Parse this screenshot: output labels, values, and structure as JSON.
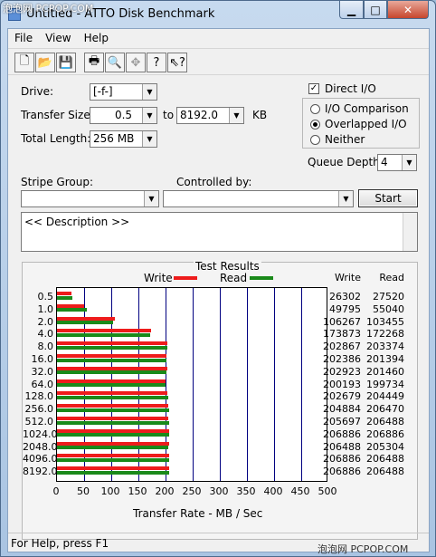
{
  "window": {
    "title": "Untitled - ATTO Disk Benchmark",
    "watermark_top": "泡泡网 PCPOP.COM",
    "watermark_bottom": "泡泡网 PCPOP.COM"
  },
  "menu": [
    "File",
    "View",
    "Help"
  ],
  "toolbar": [
    "new-icon",
    "open-icon",
    "save-icon",
    "print-icon",
    "print-preview-icon",
    "move-icon",
    "help-icon",
    "context-help-icon"
  ],
  "settings": {
    "drive_label": "Drive:",
    "drive_value": "[-f-]",
    "transfer_label": "Transfer Size:",
    "transfer_from": "0.5",
    "to_label": "to",
    "transfer_to": "8192.0",
    "kb_label": "KB",
    "length_label": "Total Length:",
    "length_value": "256 MB",
    "direct_io": "Direct I/O",
    "io_comparison": "I/O Comparison",
    "overlapped_io": "Overlapped I/O",
    "neither": "Neither",
    "queue_label": "Queue Depth:",
    "queue_value": "4",
    "stripe_label": "Stripe Group:",
    "controlled_label": "Controlled by:",
    "start_button": "Start",
    "description": "<< Description >>"
  },
  "results": {
    "title": "Test Results",
    "legend_write": "Write",
    "legend_read": "Read",
    "col_write": "Write",
    "col_read": "Read",
    "xlabel": "Transfer Rate - MB / Sec",
    "xticks": [
      "0",
      "50",
      "100",
      "150",
      "200",
      "250",
      "300",
      "350",
      "400",
      "450",
      "500"
    ]
  },
  "chart_data": {
    "type": "bar",
    "title": "Test Results",
    "xlabel": "Transfer Rate - MB / Sec",
    "xlim": [
      0,
      500
    ],
    "categories": [
      "0.5",
      "1.0",
      "2.0",
      "4.0",
      "8.0",
      "16.0",
      "32.0",
      "64.0",
      "128.0",
      "256.0",
      "512.0",
      "1024.0",
      "2048.0",
      "4096.0",
      "8192.0"
    ],
    "series": [
      {
        "name": "Write",
        "color": "#ee1c1c",
        "values": [
          26302,
          49795,
          106267,
          173873,
          202867,
          202386,
          202923,
          200193,
          202679,
          204884,
          205697,
          206886,
          206488,
          206886,
          206886
        ]
      },
      {
        "name": "Read",
        "color": "#1a8a1a",
        "values": [
          27520,
          55040,
          103455,
          172268,
          203374,
          201394,
          201460,
          199734,
          204449,
          206470,
          206488,
          206886,
          205304,
          206488,
          206488
        ]
      }
    ]
  },
  "status": {
    "text": "For Help, press F1"
  }
}
